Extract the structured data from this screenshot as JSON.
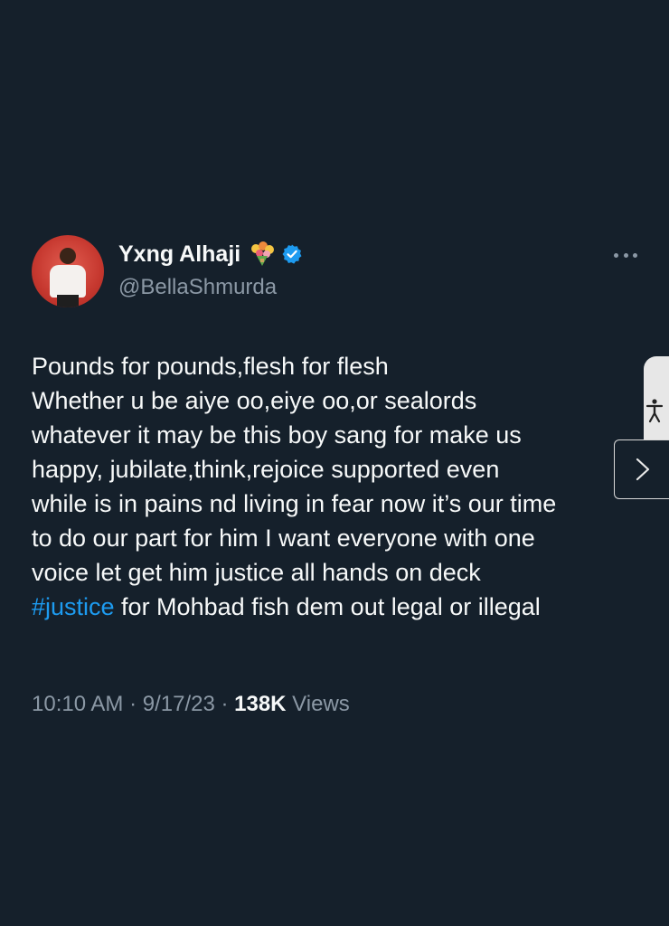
{
  "author": {
    "display_name": "Yxng Alhaji",
    "handle": "@BellaShmurda",
    "avatar_icon": "profile-photo",
    "name_emoji_icon": "bouquet-icon",
    "verified_icon": "verified-badge-icon",
    "verified_color": "#1d9bf0"
  },
  "tweet": {
    "lines": [
      "Pounds for pounds,flesh for flesh",
      "Whether u be aiye oo,eiye oo,or sealords",
      "whatever it may be this boy sang for make us",
      "happy, jubilate,think,rejoice supported even",
      "while is in pains nd living in fear now it’s our time",
      "to do our part for him I want everyone with one",
      "voice let get him justice all hands on deck"
    ],
    "last_line_hashtag": "#justice",
    "last_line_rest": " for Mohbad fish dem out legal or illegal",
    "hashtag_color": "#1d9bf0"
  },
  "meta": {
    "time": "10:10 AM",
    "separator": " · ",
    "date": "9/17/23",
    "views_count": "138K",
    "views_label": " Views"
  },
  "overlay": {
    "accessibility_icon": "accessibility-icon",
    "next_icon": "chevron-right-icon"
  },
  "colors": {
    "background": "#15202b",
    "primary_text": "#f7f9f9",
    "secondary_text": "#8b98a5"
  }
}
